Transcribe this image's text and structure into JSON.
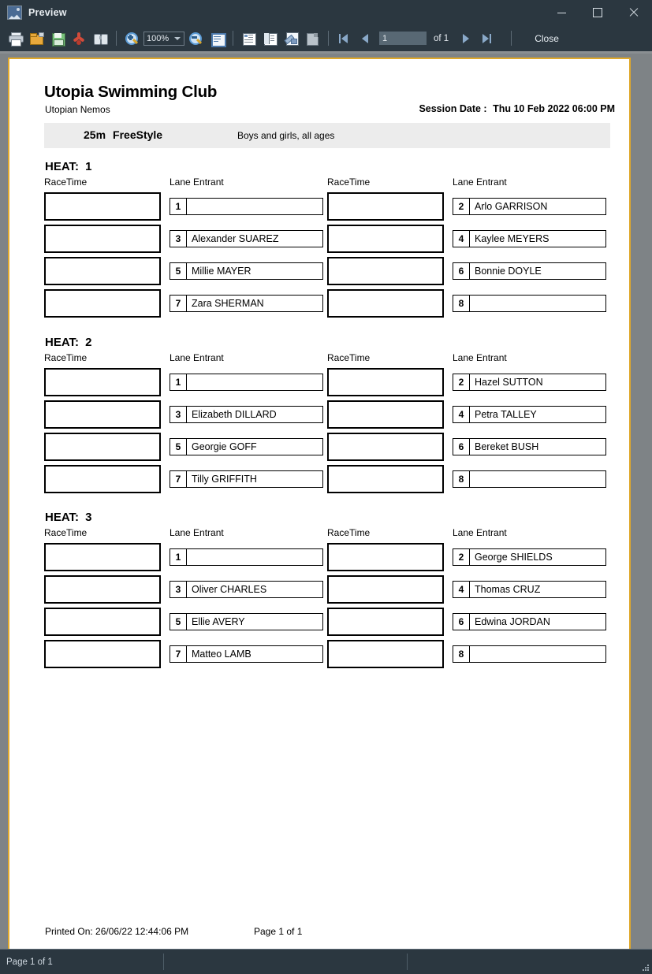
{
  "window": {
    "title": "Preview",
    "icon": "preview-image-icon",
    "minimize_label": "Minimize",
    "maximize_label": "Maximize",
    "close_label": "Close"
  },
  "toolbar": {
    "icons": [
      {
        "name": "print-icon",
        "label": "Print"
      },
      {
        "name": "open-folder-icon",
        "label": "Open"
      },
      {
        "name": "save-floppy-icon",
        "label": "Save"
      },
      {
        "name": "export-pdf-icon",
        "label": "Export PDF"
      },
      {
        "name": "find-binoculars-icon",
        "label": "Find"
      },
      {
        "name": "zoom-in-icon",
        "label": "Zoom In"
      },
      {
        "name": "zoom-out-icon",
        "label": "Zoom Out"
      },
      {
        "name": "single-page-icon",
        "label": "Single Page"
      },
      {
        "name": "page-layout-icon",
        "label": "Page Layout"
      },
      {
        "name": "page-thumbnails-icon",
        "label": "Thumbnails"
      },
      {
        "name": "page-setup-icon",
        "label": "Page Setup"
      },
      {
        "name": "stop-render-icon",
        "label": "Stop"
      }
    ],
    "zoom_value": "100%",
    "nav": {
      "first_label": "First Page",
      "prev_label": "Previous Page",
      "page_value": "1",
      "of_label": "of 1",
      "next_label": "Next Page",
      "last_label": "Last Page"
    },
    "close_label": "Close"
  },
  "report": {
    "club_name": "Utopia Swimming Club",
    "club_sub": "Utopian Nemos",
    "session_label": "Session Date :",
    "session_date": "Thu 10 Feb 2022 06:00 PM",
    "event_distance": "25m",
    "event_stroke": "FreeStyle",
    "event_description": "Boys and girls, all ages",
    "col_racetime": "RaceTime",
    "col_lane_entrant": "Lane Entrant",
    "heat_label": "HEAT:",
    "printed_on": "Printed On: 26/06/22 12:44:06 PM",
    "page_of": "Page 1 of 1",
    "heats": [
      {
        "number": "1",
        "left": [
          {
            "lane": "1",
            "entrant": ""
          },
          {
            "lane": "3",
            "entrant": "Alexander SUAREZ"
          },
          {
            "lane": "5",
            "entrant": "Millie MAYER"
          },
          {
            "lane": "7",
            "entrant": "Zara SHERMAN"
          }
        ],
        "right": [
          {
            "lane": "2",
            "entrant": "Arlo GARRISON"
          },
          {
            "lane": "4",
            "entrant": "Kaylee MEYERS"
          },
          {
            "lane": "6",
            "entrant": "Bonnie DOYLE"
          },
          {
            "lane": "8",
            "entrant": ""
          }
        ]
      },
      {
        "number": "2",
        "left": [
          {
            "lane": "1",
            "entrant": ""
          },
          {
            "lane": "3",
            "entrant": "Elizabeth DILLARD"
          },
          {
            "lane": "5",
            "entrant": "Georgie GOFF"
          },
          {
            "lane": "7",
            "entrant": "Tilly GRIFFITH"
          }
        ],
        "right": [
          {
            "lane": "2",
            "entrant": "Hazel SUTTON"
          },
          {
            "lane": "4",
            "entrant": "Petra TALLEY"
          },
          {
            "lane": "6",
            "entrant": "Bereket BUSH"
          },
          {
            "lane": "8",
            "entrant": ""
          }
        ]
      },
      {
        "number": "3",
        "left": [
          {
            "lane": "1",
            "entrant": ""
          },
          {
            "lane": "3",
            "entrant": "Oliver CHARLES"
          },
          {
            "lane": "5",
            "entrant": "Ellie AVERY"
          },
          {
            "lane": "7",
            "entrant": "Matteo LAMB"
          }
        ],
        "right": [
          {
            "lane": "2",
            "entrant": "George SHIELDS"
          },
          {
            "lane": "4",
            "entrant": "Thomas CRUZ"
          },
          {
            "lane": "6",
            "entrant": "Edwina JORDAN"
          },
          {
            "lane": "8",
            "entrant": ""
          }
        ]
      }
    ]
  },
  "statusbar": {
    "page_status": "Page 1 of 1"
  },
  "colors": {
    "chrome": "#2b3740",
    "paper_border": "#e0a92b",
    "preview_bg": "#7e8386",
    "band": "#ececec"
  }
}
